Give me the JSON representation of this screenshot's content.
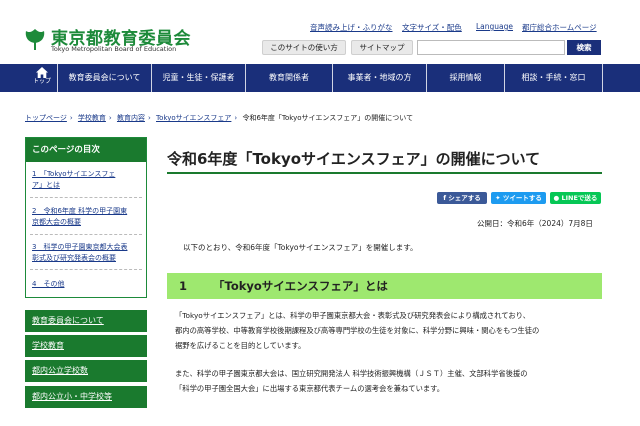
{
  "header": {
    "logo_name": "東京都教育委員会",
    "logo_sub": "Tokyo Metropolitan Board of Education",
    "utility_links": [
      "音声読み上げ・ふりがな",
      "文字サイズ・配色",
      "Language",
      "都庁総合ホームページ"
    ],
    "about_site": "このサイトの使い方",
    "sitemap": "サイトマップ",
    "search_placeholder": "",
    "search_button": "検索",
    "brand_color": "#1d8a3a"
  },
  "nav": {
    "home_label": "トップ",
    "items": [
      "教育委員会について",
      "児童・生徒・保護者",
      "教育関係者",
      "事業者・地域の方",
      "採用情報",
      "相談・手続・窓口"
    ],
    "nav_color": "#1a2f7a"
  },
  "breadcrumb": {
    "links": [
      "トップページ",
      "学校教育",
      "教育内容",
      "Tokyoサイエンスフェア"
    ],
    "current": "令和6年度「Tokyoサイエンスフェア」の開催について"
  },
  "sidebar": {
    "toc_title": "このページの目次",
    "toc_items": [
      [
        "1　「Tokyoサイエンスフェ",
        "ア」とは"
      ],
      [
        "2　令和6年度 科学の甲子園東",
        "京都大会の概要"
      ],
      [
        "3　科学の甲子園東京都大会表",
        "彰式及び研究発表会の概要"
      ],
      [
        "4　その他"
      ]
    ],
    "nav_items": [
      "教育委員会について",
      "学校教育",
      "都内公立学校数",
      "都内公立小・中学校等"
    ],
    "accent_color": "#1a7a2e"
  },
  "main": {
    "title": "令和6年度「Tokyoサイエンスフェア」の開催について",
    "share": {
      "facebook": "シェアする",
      "twitter": "ツイートする",
      "line": "LINEで送る"
    },
    "published": "公開日：令和6年（2024）7月8日",
    "intro": "以下のとおり、令和6年度「Tokyoサイエンスフェア」を開催します。",
    "section": {
      "number": "1",
      "title": "「Tokyoサイエンスフェア」とは",
      "color": "#9ee86f"
    },
    "paragraphs": [
      [
        "「Tokyoサイエンスフェア」とは、科学の甲子園東京都大会・表彰式及び研究発表会により構成されており、",
        "都内の高等学校、中等教育学校後期課程及び高等専門学校の生徒を対象に、科学分野に興味・関心をもつ生徒の",
        "裾野を広げることを目的としています。"
      ],
      [
        "また、科学の甲子園東京都大会は、国立研究開発法人 科学技術振興機構（ＪＳＴ）主催、文部科学省後援の",
        "「科学の甲子園全国大会」に出場する東京都代表チームの選考会を兼ねています。"
      ]
    ]
  }
}
